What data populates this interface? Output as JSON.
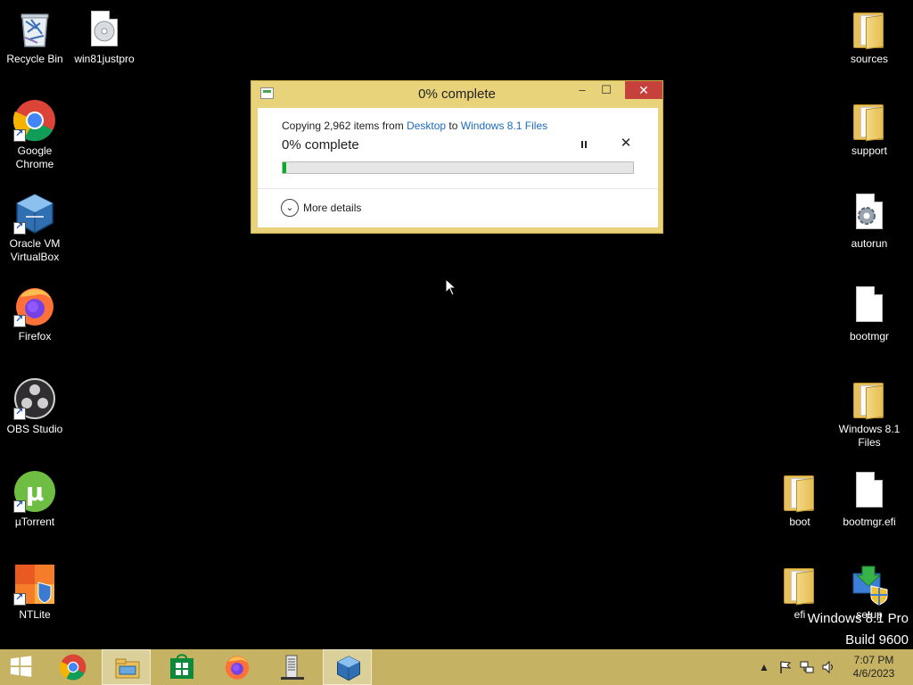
{
  "desktop": {
    "left_icons": [
      {
        "label": "Recycle Bin",
        "icon": "recycle-bin-icon"
      },
      {
        "label": "win81justpro",
        "icon": "disc-image-icon"
      },
      {
        "label": "Google Chrome",
        "icon": "chrome-icon"
      },
      {
        "label": "Oracle VM VirtualBox",
        "icon": "virtualbox-icon"
      },
      {
        "label": "Firefox",
        "icon": "firefox-icon"
      },
      {
        "label": "OBS Studio",
        "icon": "obs-icon"
      },
      {
        "label": "µTorrent",
        "icon": "utorrent-icon"
      },
      {
        "label": "NTLite",
        "icon": "ntlite-icon"
      }
    ],
    "right_icons": [
      {
        "label": "sources",
        "icon": "folder-icon"
      },
      {
        "label": "support",
        "icon": "folder-icon"
      },
      {
        "label": "autorun",
        "icon": "settings-file-icon"
      },
      {
        "label": "bootmgr",
        "icon": "file-icon"
      },
      {
        "label": "Windows 8.1 Files",
        "icon": "folder-icon"
      },
      {
        "label": "boot",
        "icon": "folder-icon"
      },
      {
        "label": "bootmgr.efi",
        "icon": "file-icon"
      },
      {
        "label": "efi",
        "icon": "folder-icon"
      },
      {
        "label": "setup",
        "icon": "setup-icon"
      }
    ],
    "watermark": {
      "line1": "Windows 8.1 Pro",
      "line2": "Build 9600"
    }
  },
  "dialog": {
    "title": "0% complete",
    "copy_prefix": "Copying 2,962 items from ",
    "source": "Desktop",
    "to_word": " to ",
    "destination": "Windows 8.1 Files",
    "percent_label": "0% complete",
    "progress_fraction": 0.01,
    "more_details": "More details",
    "min_glyph": "–",
    "max_glyph": "☐",
    "close_glyph": "✕",
    "cancel_glyph": "✕",
    "toggle_glyph": "⌄"
  },
  "taskbar": {
    "items": [
      "start-button",
      "chrome",
      "file-explorer",
      "store",
      "firefox",
      "server-app",
      "virtualbox"
    ],
    "active_item": "file-explorer",
    "clock": {
      "time": "7:07 PM",
      "date": "4/6/2023"
    }
  },
  "colors": {
    "accent": "#c5b262",
    "dialog_frame": "#e8d37a",
    "progress_fill": "#06b025",
    "link": "#1c6bbf"
  }
}
